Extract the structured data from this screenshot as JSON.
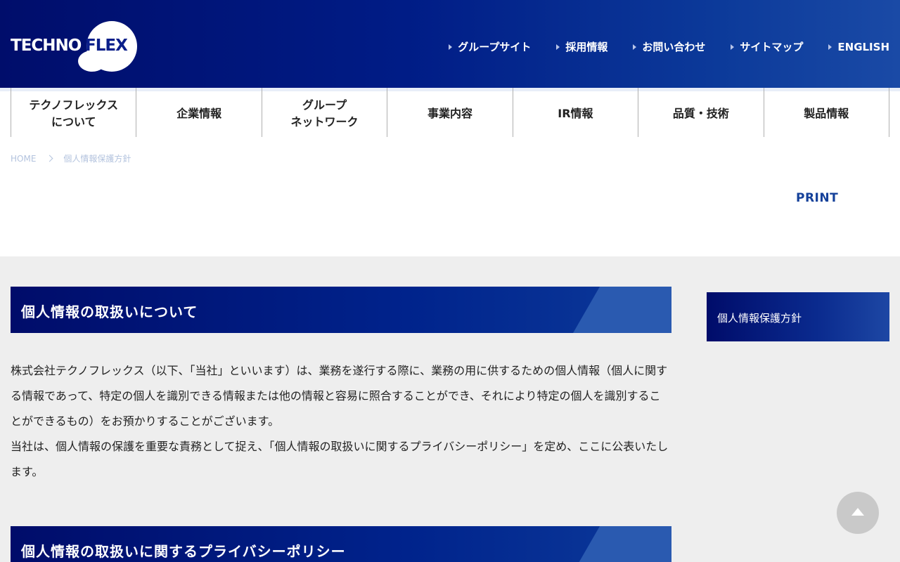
{
  "logo": {
    "part1": "TECHNO",
    "part2": "FLEX"
  },
  "topnav": [
    {
      "label": "グループサイト"
    },
    {
      "label": "採用情報"
    },
    {
      "label": "お問い合わせ"
    },
    {
      "label": "サイトマップ"
    },
    {
      "label": "ENGLISH"
    }
  ],
  "mainnav": [
    {
      "label": "テクノフレックス\nについて"
    },
    {
      "label": "企業情報"
    },
    {
      "label": "グループ\nネットワーク"
    },
    {
      "label": "事業内容"
    },
    {
      "label": "IR情報"
    },
    {
      "label": "品質・技術"
    },
    {
      "label": "製品情報"
    }
  ],
  "breadcrumb": {
    "home": "HOME",
    "current": "個人情報保護方針"
  },
  "print_label": "PRINT",
  "sections": [
    {
      "title": "個人情報の取扱いについて"
    },
    {
      "title": "個人情報の取扱いに関するプライバシーポリシー"
    }
  ],
  "body": {
    "p1": "株式会社テクノフレックス（以下、「当社」といいます）は、業務を遂行する際に、業務の用に供するための個人情報（個人に関する情報であって、特定の個人を識別できる情報または他の情報と容易に照合することができ、それにより特定の個人を識別することができるもの）をお預かりすることがございます。",
    "p2": "当社は、個人情報の保護を重要な責務として捉え、「個人情報の取扱いに関するプライバシーポリシー」を定め、ここに公表いたします。"
  },
  "sidebar": {
    "item": "個人情報保護方針"
  },
  "colors": {
    "header_dark": "#000d6b",
    "accent": "#15419a",
    "background": "#eeeeee"
  }
}
